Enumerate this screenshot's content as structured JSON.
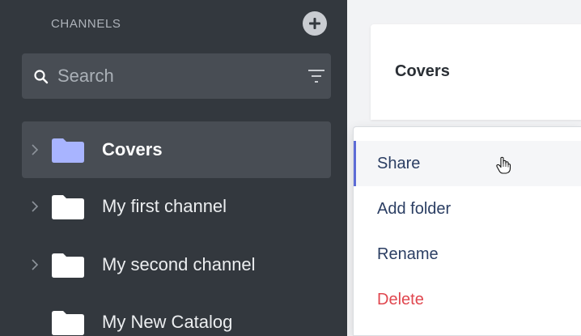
{
  "sidebar": {
    "header": "CHANNELS",
    "add_icon": "plus-circle-icon",
    "search": {
      "placeholder": "Search",
      "search_icon": "search-icon",
      "filter_icon": "filter-icon"
    },
    "items": [
      {
        "label": "Covers",
        "selected": true,
        "has_children": true,
        "folder_color": "#a8b4ff"
      },
      {
        "label": "My first channel",
        "selected": false,
        "has_children": true,
        "folder_color": "#ffffff"
      },
      {
        "label": "My second channel",
        "selected": false,
        "has_children": true,
        "folder_color": "#ffffff"
      },
      {
        "label": "My New Catalog",
        "selected": false,
        "has_children": false,
        "folder_color": "#ffffff"
      }
    ]
  },
  "main": {
    "card_title": "Covers"
  },
  "context_menu": {
    "items": [
      {
        "label": "Share",
        "active": true
      },
      {
        "label": "Add folder",
        "active": false
      },
      {
        "label": "Rename",
        "active": false
      },
      {
        "label": "Delete",
        "active": false,
        "danger": true
      }
    ]
  },
  "colors": {
    "sidebar_bg": "#33383e",
    "selected_bg": "#484d54",
    "accent": "#5c6bd6",
    "danger": "#e0474f",
    "menu_text": "#2b3e63"
  },
  "cursor": "hand-pointer-icon"
}
